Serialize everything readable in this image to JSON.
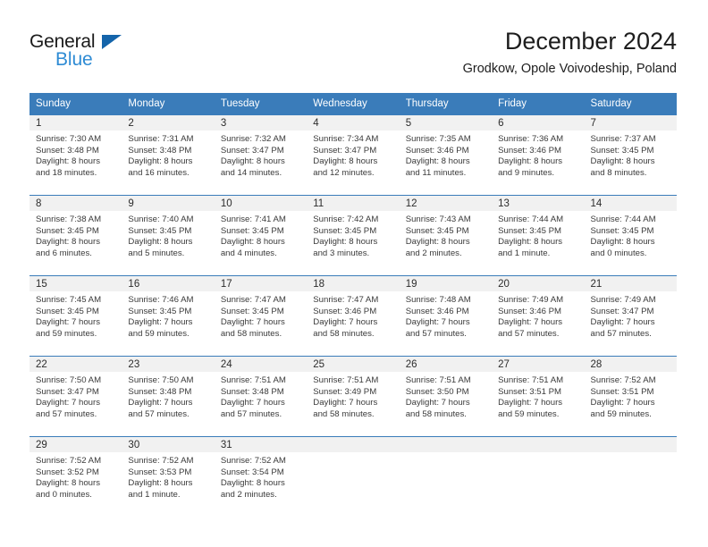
{
  "brand": {
    "name_part1": "General",
    "name_part2": "Blue",
    "triangle_icon": "triangle-icon",
    "color_dark": "#1a1a1a",
    "color_blue": "#2e8bd4",
    "color_triangle": "#1464aa"
  },
  "header": {
    "title": "December 2024",
    "subtitle": "Grodkow, Opole Voivodeship, Poland"
  },
  "theme": {
    "header_bg": "#3a7cba",
    "header_text": "#ffffff",
    "daynum_bg": "#f1f1f1",
    "row_border": "#3a7cba",
    "page_bg": "#ffffff"
  },
  "weekday_headers": [
    "Sunday",
    "Monday",
    "Tuesday",
    "Wednesday",
    "Thursday",
    "Friday",
    "Saturday"
  ],
  "weeks": [
    [
      {
        "day": "1",
        "sunrise": "Sunrise: 7:30 AM",
        "sunset": "Sunset: 3:48 PM",
        "daylight1": "Daylight: 8 hours",
        "daylight2": "and 18 minutes."
      },
      {
        "day": "2",
        "sunrise": "Sunrise: 7:31 AM",
        "sunset": "Sunset: 3:48 PM",
        "daylight1": "Daylight: 8 hours",
        "daylight2": "and 16 minutes."
      },
      {
        "day": "3",
        "sunrise": "Sunrise: 7:32 AM",
        "sunset": "Sunset: 3:47 PM",
        "daylight1": "Daylight: 8 hours",
        "daylight2": "and 14 minutes."
      },
      {
        "day": "4",
        "sunrise": "Sunrise: 7:34 AM",
        "sunset": "Sunset: 3:47 PM",
        "daylight1": "Daylight: 8 hours",
        "daylight2": "and 12 minutes."
      },
      {
        "day": "5",
        "sunrise": "Sunrise: 7:35 AM",
        "sunset": "Sunset: 3:46 PM",
        "daylight1": "Daylight: 8 hours",
        "daylight2": "and 11 minutes."
      },
      {
        "day": "6",
        "sunrise": "Sunrise: 7:36 AM",
        "sunset": "Sunset: 3:46 PM",
        "daylight1": "Daylight: 8 hours",
        "daylight2": "and 9 minutes."
      },
      {
        "day": "7",
        "sunrise": "Sunrise: 7:37 AM",
        "sunset": "Sunset: 3:45 PM",
        "daylight1": "Daylight: 8 hours",
        "daylight2": "and 8 minutes."
      }
    ],
    [
      {
        "day": "8",
        "sunrise": "Sunrise: 7:38 AM",
        "sunset": "Sunset: 3:45 PM",
        "daylight1": "Daylight: 8 hours",
        "daylight2": "and 6 minutes."
      },
      {
        "day": "9",
        "sunrise": "Sunrise: 7:40 AM",
        "sunset": "Sunset: 3:45 PM",
        "daylight1": "Daylight: 8 hours",
        "daylight2": "and 5 minutes."
      },
      {
        "day": "10",
        "sunrise": "Sunrise: 7:41 AM",
        "sunset": "Sunset: 3:45 PM",
        "daylight1": "Daylight: 8 hours",
        "daylight2": "and 4 minutes."
      },
      {
        "day": "11",
        "sunrise": "Sunrise: 7:42 AM",
        "sunset": "Sunset: 3:45 PM",
        "daylight1": "Daylight: 8 hours",
        "daylight2": "and 3 minutes."
      },
      {
        "day": "12",
        "sunrise": "Sunrise: 7:43 AM",
        "sunset": "Sunset: 3:45 PM",
        "daylight1": "Daylight: 8 hours",
        "daylight2": "and 2 minutes."
      },
      {
        "day": "13",
        "sunrise": "Sunrise: 7:44 AM",
        "sunset": "Sunset: 3:45 PM",
        "daylight1": "Daylight: 8 hours",
        "daylight2": "and 1 minute."
      },
      {
        "day": "14",
        "sunrise": "Sunrise: 7:44 AM",
        "sunset": "Sunset: 3:45 PM",
        "daylight1": "Daylight: 8 hours",
        "daylight2": "and 0 minutes."
      }
    ],
    [
      {
        "day": "15",
        "sunrise": "Sunrise: 7:45 AM",
        "sunset": "Sunset: 3:45 PM",
        "daylight1": "Daylight: 7 hours",
        "daylight2": "and 59 minutes."
      },
      {
        "day": "16",
        "sunrise": "Sunrise: 7:46 AM",
        "sunset": "Sunset: 3:45 PM",
        "daylight1": "Daylight: 7 hours",
        "daylight2": "and 59 minutes."
      },
      {
        "day": "17",
        "sunrise": "Sunrise: 7:47 AM",
        "sunset": "Sunset: 3:45 PM",
        "daylight1": "Daylight: 7 hours",
        "daylight2": "and 58 minutes."
      },
      {
        "day": "18",
        "sunrise": "Sunrise: 7:47 AM",
        "sunset": "Sunset: 3:46 PM",
        "daylight1": "Daylight: 7 hours",
        "daylight2": "and 58 minutes."
      },
      {
        "day": "19",
        "sunrise": "Sunrise: 7:48 AM",
        "sunset": "Sunset: 3:46 PM",
        "daylight1": "Daylight: 7 hours",
        "daylight2": "and 57 minutes."
      },
      {
        "day": "20",
        "sunrise": "Sunrise: 7:49 AM",
        "sunset": "Sunset: 3:46 PM",
        "daylight1": "Daylight: 7 hours",
        "daylight2": "and 57 minutes."
      },
      {
        "day": "21",
        "sunrise": "Sunrise: 7:49 AM",
        "sunset": "Sunset: 3:47 PM",
        "daylight1": "Daylight: 7 hours",
        "daylight2": "and 57 minutes."
      }
    ],
    [
      {
        "day": "22",
        "sunrise": "Sunrise: 7:50 AM",
        "sunset": "Sunset: 3:47 PM",
        "daylight1": "Daylight: 7 hours",
        "daylight2": "and 57 minutes."
      },
      {
        "day": "23",
        "sunrise": "Sunrise: 7:50 AM",
        "sunset": "Sunset: 3:48 PM",
        "daylight1": "Daylight: 7 hours",
        "daylight2": "and 57 minutes."
      },
      {
        "day": "24",
        "sunrise": "Sunrise: 7:51 AM",
        "sunset": "Sunset: 3:48 PM",
        "daylight1": "Daylight: 7 hours",
        "daylight2": "and 57 minutes."
      },
      {
        "day": "25",
        "sunrise": "Sunrise: 7:51 AM",
        "sunset": "Sunset: 3:49 PM",
        "daylight1": "Daylight: 7 hours",
        "daylight2": "and 58 minutes."
      },
      {
        "day": "26",
        "sunrise": "Sunrise: 7:51 AM",
        "sunset": "Sunset: 3:50 PM",
        "daylight1": "Daylight: 7 hours",
        "daylight2": "and 58 minutes."
      },
      {
        "day": "27",
        "sunrise": "Sunrise: 7:51 AM",
        "sunset": "Sunset: 3:51 PM",
        "daylight1": "Daylight: 7 hours",
        "daylight2": "and 59 minutes."
      },
      {
        "day": "28",
        "sunrise": "Sunrise: 7:52 AM",
        "sunset": "Sunset: 3:51 PM",
        "daylight1": "Daylight: 7 hours",
        "daylight2": "and 59 minutes."
      }
    ],
    [
      {
        "day": "29",
        "sunrise": "Sunrise: 7:52 AM",
        "sunset": "Sunset: 3:52 PM",
        "daylight1": "Daylight: 8 hours",
        "daylight2": "and 0 minutes."
      },
      {
        "day": "30",
        "sunrise": "Sunrise: 7:52 AM",
        "sunset": "Sunset: 3:53 PM",
        "daylight1": "Daylight: 8 hours",
        "daylight2": "and 1 minute."
      },
      {
        "day": "31",
        "sunrise": "Sunrise: 7:52 AM",
        "sunset": "Sunset: 3:54 PM",
        "daylight1": "Daylight: 8 hours",
        "daylight2": "and 2 minutes."
      },
      {
        "day": "",
        "sunrise": "",
        "sunset": "",
        "daylight1": "",
        "daylight2": ""
      },
      {
        "day": "",
        "sunrise": "",
        "sunset": "",
        "daylight1": "",
        "daylight2": ""
      },
      {
        "day": "",
        "sunrise": "",
        "sunset": "",
        "daylight1": "",
        "daylight2": ""
      },
      {
        "day": "",
        "sunrise": "",
        "sunset": "",
        "daylight1": "",
        "daylight2": ""
      }
    ]
  ]
}
